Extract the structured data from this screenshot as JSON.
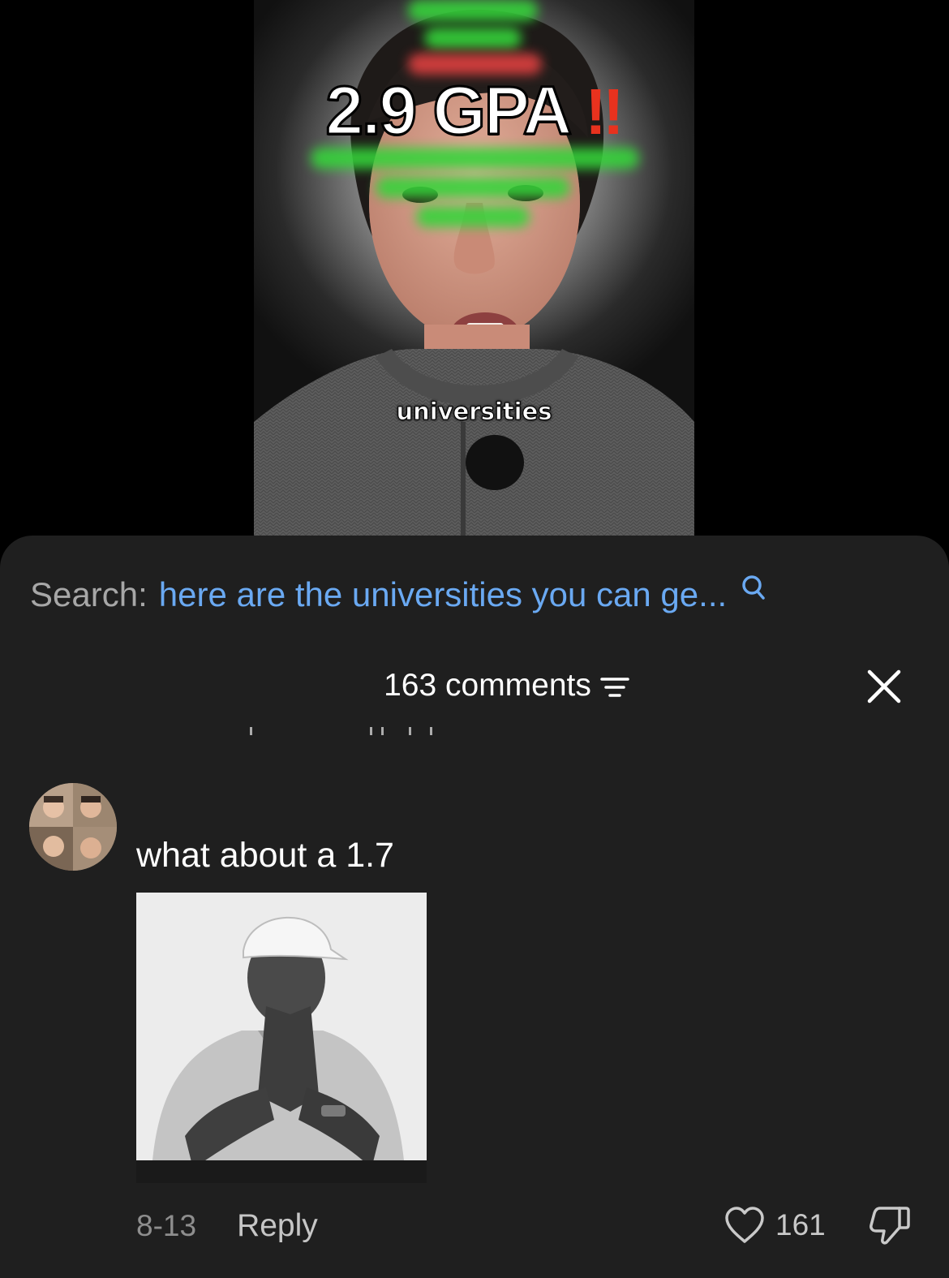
{
  "video": {
    "overlay_title": "2.9 GPA",
    "overlay_emoji": "‼",
    "caption": "universities"
  },
  "search": {
    "label": "Search:",
    "query": "here are the universities you can ge..."
  },
  "comments": {
    "count_label": "163 comments"
  },
  "comment": {
    "text": "what about a 1.7",
    "date": "8-13",
    "reply_label": "Reply",
    "like_count": "161"
  },
  "colors": {
    "sheet_bg": "#1f1f1f",
    "search_query": "#6aa9f2",
    "emoji_red": "#e8321e"
  }
}
